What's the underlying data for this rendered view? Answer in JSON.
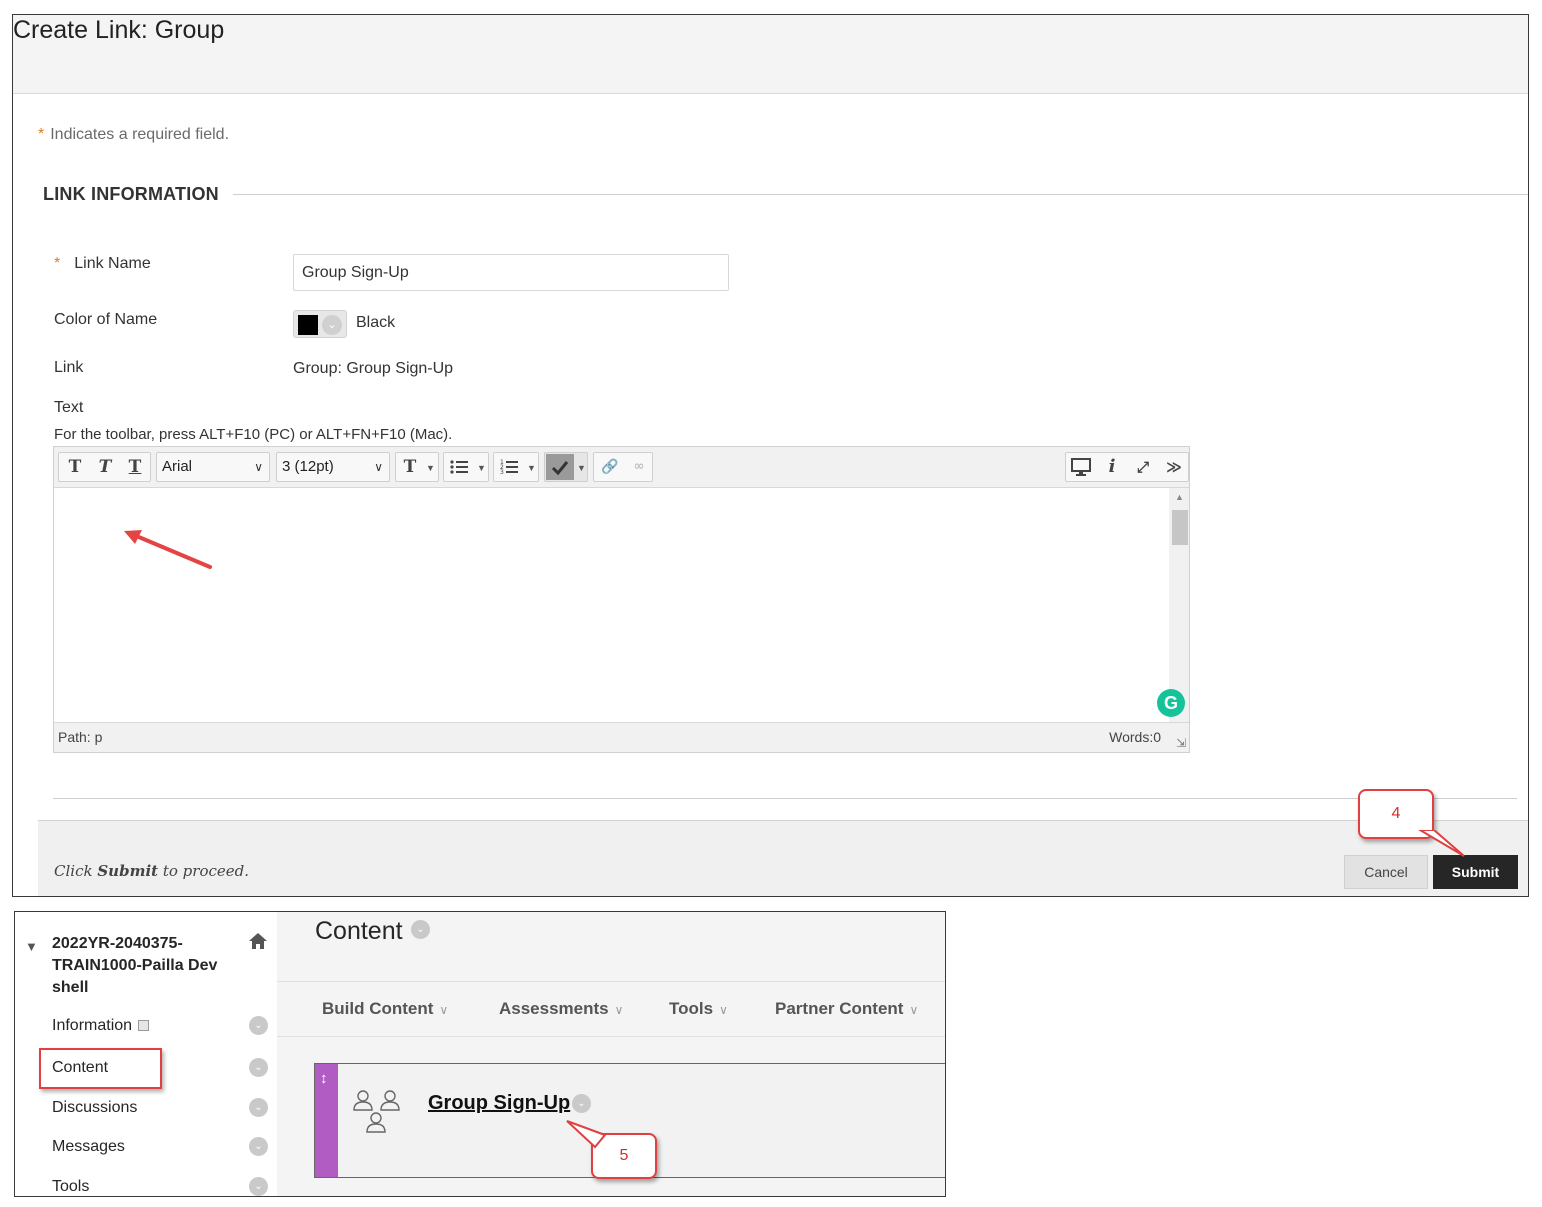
{
  "create_link": {
    "title": "Create Link: Group",
    "required_note": "Indicates a required field.",
    "required_star": "*",
    "section_title": "LINK INFORMATION",
    "link_name_label": "Link Name",
    "link_name_value": "Group Sign-Up",
    "color_label": "Color of Name",
    "color_value": "Black",
    "color_hex": "#000000",
    "link_label": "Link",
    "link_value": "Group: Group Sign-Up",
    "text_label": "Text",
    "toolbar_hint": "For the toolbar, press ALT+F10 (PC) or ALT+FN+F10 (Mac).",
    "editor": {
      "font_family": "Arial",
      "font_size": "3 (12pt)",
      "path": "Path: p",
      "words": "Words:0",
      "grammarly": "G"
    },
    "footer_note_prefix": "Click ",
    "footer_note_bold": "Submit",
    "footer_note_suffix": " to proceed.",
    "cancel_label": "Cancel",
    "submit_label": "Submit",
    "callout_4": "4"
  },
  "course": {
    "name": "2022YR-2040375-TRAIN1000-Pailla Dev shell",
    "menu_items": [
      "Information",
      "Content",
      "Discussions",
      "Messages",
      "Tools"
    ]
  },
  "content": {
    "title": "Content",
    "actions": [
      "Build Content",
      "Assessments",
      "Tools",
      "Partner Content"
    ],
    "item_title": "Group Sign-Up",
    "callout_5": "5"
  },
  "colors": {
    "accent_callout": "#e04040",
    "item_strip": "#b05cc2",
    "submit_bg": "#262626",
    "required_star": "#e07c2a"
  }
}
